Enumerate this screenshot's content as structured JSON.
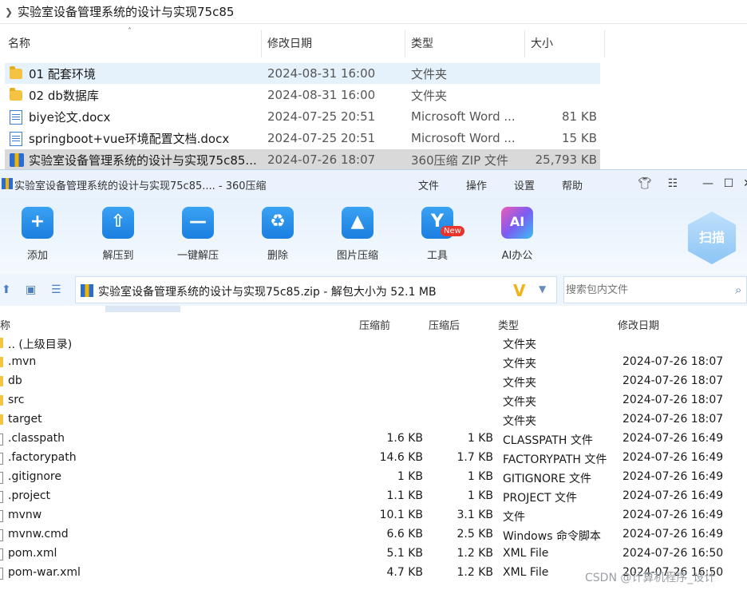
{
  "explorer": {
    "path": "实验室设备管理系统的设计与实现75c85",
    "headers": {
      "name": "名称",
      "date": "修改日期",
      "type": "类型",
      "size": "大小"
    },
    "rows": [
      {
        "name": "01 配套环境",
        "date": "2024-08-31 16:00",
        "type": "文件夹",
        "size": "",
        "icon": "folder-icon"
      },
      {
        "name": "02 db数据库",
        "date": "2024-08-31 16:00",
        "type": "文件夹",
        "size": "",
        "icon": "folder-icon"
      },
      {
        "name": "biye论文.docx",
        "date": "2024-07-25 20:51",
        "type": "Microsoft Word ...",
        "size": "81 KB",
        "icon": "word-doc-icon"
      },
      {
        "name": "springboot+vue环境配置文档.docx",
        "date": "2024-07-25 20:51",
        "type": "Microsoft Word ...",
        "size": "15 KB",
        "icon": "word-doc-icon"
      },
      {
        "name": "实验室设备管理系统的设计与实现75c85...",
        "date": "2024-07-26 18:07",
        "type": "360压缩 ZIP 文件",
        "size": "25,793 KB",
        "icon": "zip-archive-icon"
      }
    ]
  },
  "zipwin": {
    "title": "实验室设备管理系统的设计与实现75c85.... - 360压缩",
    "menu": [
      "文件",
      "操作",
      "设置",
      "帮助"
    ],
    "tools": [
      {
        "label": "添加",
        "glyph": "+"
      },
      {
        "label": "解压到",
        "glyph": "⇧"
      },
      {
        "label": "一键解压",
        "glyph": "—"
      },
      {
        "label": "删除",
        "glyph": "♻"
      },
      {
        "label": "图片压缩",
        "glyph": "▲"
      },
      {
        "label": "工具",
        "glyph": "Y"
      },
      {
        "label": "AI办公",
        "glyph": "AI"
      }
    ],
    "new_badge": "New",
    "scan_label": "扫描",
    "path_text": "实验室设备管理系统的设计与实现75c85.zip - 解包大小为 52.1 MB",
    "search_placeholder": "搜索包内文件",
    "list_headers": {
      "name": "称",
      "before": "压缩前",
      "after": "压缩后",
      "type": "类型",
      "date": "修改日期"
    },
    "rows": [
      {
        "name": ".. (上级目录)",
        "before": "",
        "after": "",
        "type": "文件夹",
        "date": "",
        "kind": "folder"
      },
      {
        "name": ".mvn",
        "before": "",
        "after": "",
        "type": "文件夹",
        "date": "2024-07-26 18:07",
        "kind": "folder"
      },
      {
        "name": "db",
        "before": "",
        "after": "",
        "type": "文件夹",
        "date": "2024-07-26 18:07",
        "kind": "folder"
      },
      {
        "name": "src",
        "before": "",
        "after": "",
        "type": "文件夹",
        "date": "2024-07-26 18:07",
        "kind": "folder"
      },
      {
        "name": "target",
        "before": "",
        "after": "",
        "type": "文件夹",
        "date": "2024-07-26 18:07",
        "kind": "folder"
      },
      {
        "name": ".classpath",
        "before": "1.6 KB",
        "after": "1 KB",
        "type": "CLASSPATH 文件",
        "date": "2024-07-26 16:49",
        "kind": "file"
      },
      {
        "name": ".factorypath",
        "before": "14.6 KB",
        "after": "1.7 KB",
        "type": "FACTORYPATH 文件",
        "date": "2024-07-26 16:49",
        "kind": "file"
      },
      {
        "name": ".gitignore",
        "before": "1 KB",
        "after": "1 KB",
        "type": "GITIGNORE 文件",
        "date": "2024-07-26 16:49",
        "kind": "file"
      },
      {
        "name": ".project",
        "before": "1.1 KB",
        "after": "1 KB",
        "type": "PROJECT 文件",
        "date": "2024-07-26 16:49",
        "kind": "file"
      },
      {
        "name": "mvnw",
        "before": "10.1 KB",
        "after": "3.1 KB",
        "type": "文件",
        "date": "2024-07-26 16:49",
        "kind": "file"
      },
      {
        "name": "mvnw.cmd",
        "before": "6.6 KB",
        "after": "2.5 KB",
        "type": "Windows 命令脚本",
        "date": "2024-07-26 16:49",
        "kind": "file"
      },
      {
        "name": "pom.xml",
        "before": "5.1 KB",
        "after": "1.2 KB",
        "type": "XML File",
        "date": "2024-07-26 16:50",
        "kind": "file"
      },
      {
        "name": "pom-war.xml",
        "before": "4.7 KB",
        "after": "1.2 KB",
        "type": "XML File",
        "date": "2024-07-26 16:50",
        "kind": "file"
      }
    ]
  },
  "watermark": "CSDN @计算机程序_设计"
}
